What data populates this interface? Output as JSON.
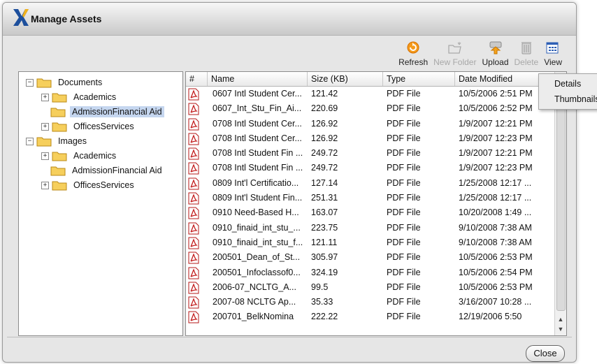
{
  "window": {
    "title": "Manage Assets"
  },
  "toolbar": {
    "refresh_label": "Refresh",
    "new_folder_label": "New Folder",
    "upload_label": "Upload",
    "delete_label": "Delete",
    "view_label": "View"
  },
  "tree": {
    "nodes": [
      {
        "label": "Documents",
        "expander": "−"
      },
      {
        "label": "Academics",
        "expander": "+"
      },
      {
        "label": "AdmissionFinancial Aid",
        "expander": ""
      },
      {
        "label": "OfficesServices",
        "expander": "+"
      },
      {
        "label": "Images",
        "expander": "−"
      },
      {
        "label": "Academics",
        "expander": "+"
      },
      {
        "label": "AdmissionFinancial Aid",
        "expander": ""
      },
      {
        "label": "OfficesServices",
        "expander": "+"
      }
    ]
  },
  "list": {
    "columns": [
      "#",
      "Name",
      "Size (KB)",
      "Type",
      "Date Modified"
    ],
    "rows": [
      {
        "name": "0607 Intl Student Cer...",
        "size": "121.42",
        "type": "PDF File",
        "date": "10/5/2006 2:51 PM"
      },
      {
        "name": "0607_Int_Stu_Fin_Ai...",
        "size": "220.69",
        "type": "PDF File",
        "date": "10/5/2006 2:52 PM"
      },
      {
        "name": "0708 Intl Student Cer...",
        "size": "126.92",
        "type": "PDF File",
        "date": "1/9/2007 12:21 PM"
      },
      {
        "name": "0708 Intl Student Cer...",
        "size": "126.92",
        "type": "PDF File",
        "date": "1/9/2007 12:23 PM"
      },
      {
        "name": "0708 Intl Student Fin ...",
        "size": "249.72",
        "type": "PDF File",
        "date": "1/9/2007 12:21 PM"
      },
      {
        "name": "0708 Intl Student Fin ...",
        "size": "249.72",
        "type": "PDF File",
        "date": "1/9/2007 12:23 PM"
      },
      {
        "name": "0809 Int'l Certificatio...",
        "size": "127.14",
        "type": "PDF File",
        "date": "1/25/2008 12:17 ..."
      },
      {
        "name": "0809 Int'l Student Fin...",
        "size": "251.31",
        "type": "PDF File",
        "date": "1/25/2008 12:17 ..."
      },
      {
        "name": "0910 Need-Based H...",
        "size": "163.07",
        "type": "PDF File",
        "date": "10/20/2008 1:49 ..."
      },
      {
        "name": "0910_finaid_int_stu_...",
        "size": "223.75",
        "type": "PDF File",
        "date": "9/10/2008 7:38 AM"
      },
      {
        "name": "0910_finaid_int_stu_f...",
        "size": "121.11",
        "type": "PDF File",
        "date": "9/10/2008 7:38 AM"
      },
      {
        "name": "200501_Dean_of_St...",
        "size": "305.97",
        "type": "PDF File",
        "date": "10/5/2006 2:53 PM"
      },
      {
        "name": "200501_Infoclassof0...",
        "size": "324.19",
        "type": "PDF File",
        "date": "10/5/2006 2:54 PM"
      },
      {
        "name": "2006-07_NCLTG_A...",
        "size": "99.5",
        "type": "PDF File",
        "date": "10/5/2006 2:53 PM"
      },
      {
        "name": "2007-08 NCLTG Ap...",
        "size": "35.33",
        "type": "PDF File",
        "date": "3/16/2007 10:28 ..."
      },
      {
        "name": "200701_BelkNomina",
        "size": "222.22",
        "type": "PDF File",
        "date": "12/19/2006 5:50"
      }
    ]
  },
  "view_menu": {
    "items": [
      "Details",
      "Thumbnails"
    ]
  },
  "footer": {
    "close_label": "Close"
  }
}
